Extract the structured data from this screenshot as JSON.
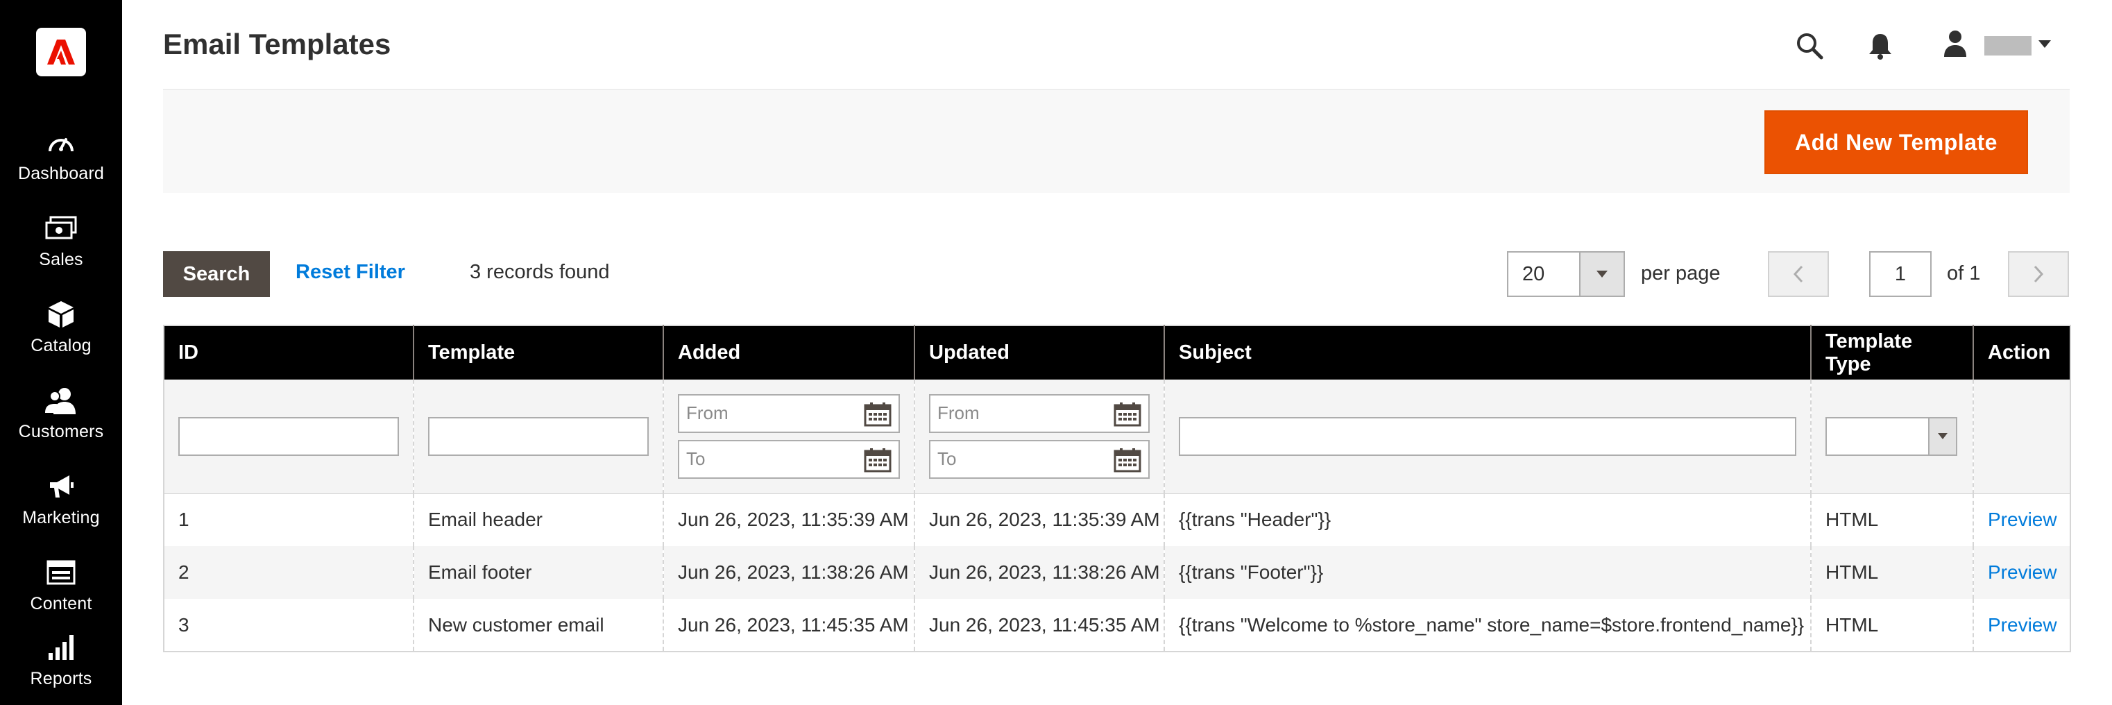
{
  "nav": {
    "items": [
      {
        "label": "Dashboard",
        "icon": "dashboard-icon"
      },
      {
        "label": "Sales",
        "icon": "sales-icon"
      },
      {
        "label": "Catalog",
        "icon": "catalog-icon"
      },
      {
        "label": "Customers",
        "icon": "customers-icon"
      },
      {
        "label": "Marketing",
        "icon": "marketing-icon"
      },
      {
        "label": "Content",
        "icon": "content-icon"
      },
      {
        "label": "Reports",
        "icon": "reports-icon"
      }
    ]
  },
  "header": {
    "title": "Email Templates",
    "icons": [
      "search-icon",
      "bell-icon",
      "user-icon"
    ]
  },
  "actions": {
    "add_new_label": "Add New Template"
  },
  "grid": {
    "search_label": "Search",
    "reset_label": "Reset Filter",
    "records_text": "3 records found",
    "per_page_value": "20",
    "per_page_label": "per page",
    "current_page": "1",
    "page_of": "of 1",
    "columns": [
      "ID",
      "Template",
      "Added",
      "Updated",
      "Subject",
      "Template Type",
      "Action"
    ],
    "filters": {
      "from_placeholder": "From",
      "to_placeholder": "To"
    },
    "rows": [
      {
        "id": "1",
        "template": "Email header",
        "added": "Jun 26, 2023, 11:35:39 AM",
        "updated": "Jun 26, 2023, 11:35:39 AM",
        "subject": "{{trans \"Header\"}}",
        "type": "HTML",
        "action": "Preview"
      },
      {
        "id": "2",
        "template": "Email footer",
        "added": "Jun 26, 2023, 11:38:26 AM",
        "updated": "Jun 26, 2023, 11:38:26 AM",
        "subject": "{{trans \"Footer\"}}",
        "type": "HTML",
        "action": "Preview"
      },
      {
        "id": "3",
        "template": "New customer email",
        "added": "Jun 26, 2023, 11:45:35 AM",
        "updated": "Jun 26, 2023, 11:45:35 AM",
        "subject": "{{trans \"Welcome to %store_name\" store_name=$store.frontend_name}}",
        "type": "HTML",
        "action": "Preview"
      }
    ]
  },
  "colors": {
    "sidebar_bg": "#000000",
    "accent": "#eb5202",
    "link": "#007bdb",
    "search_button": "#514943"
  }
}
